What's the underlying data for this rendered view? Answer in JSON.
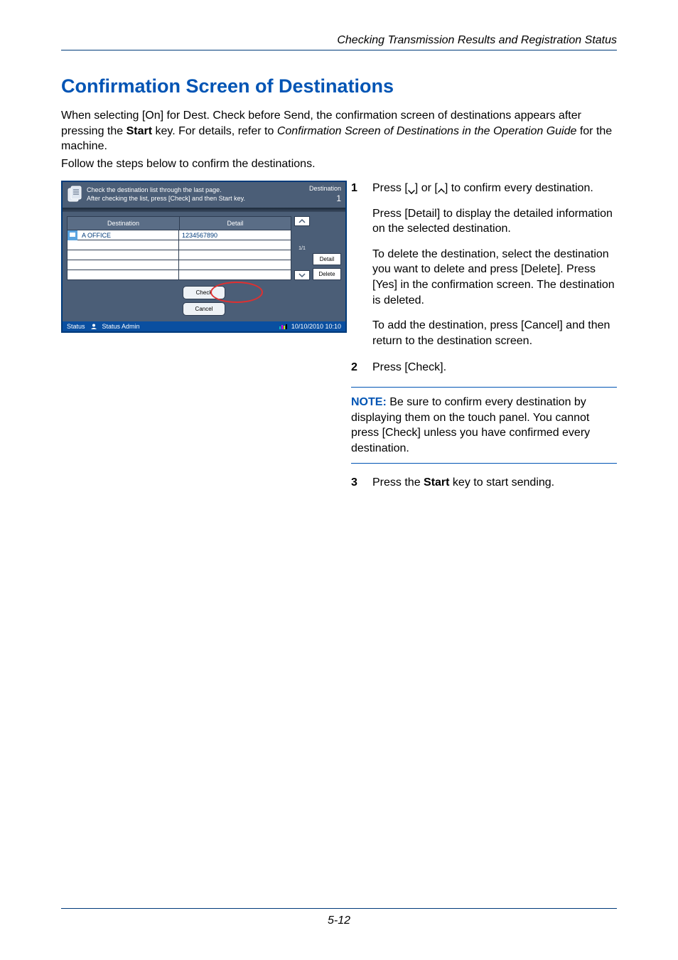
{
  "header": {
    "running": "Checking Transmission Results and Registration Status"
  },
  "title": "Confirmation Screen of Destinations",
  "intro": {
    "l1a": "When selecting [On] for Dest. Check before Send, the confirmation screen of destinations appears after",
    "l2a": "pressing the ",
    "l2b": "Start",
    "l2c": " key. For details, refer to ",
    "l2d": "Confirmation Screen of Destinations in the Operation Guide",
    "l2e": " for the",
    "l3": "machine."
  },
  "follow": "Follow the steps below to confirm the destinations.",
  "screenshot": {
    "header_line1": "Check the destination list through the last page.",
    "header_line2": "After checking the list, press [Check] and then Start key.",
    "header_right_label": "Destination",
    "header_right_count": "1",
    "col_dest": "Destination",
    "col_detail": "Detail",
    "row1_dest": "A OFFICE",
    "row1_detail": "1234567890",
    "page": "1/1",
    "btn_detail": "Detail",
    "btn_delete": "Delete",
    "btn_cancel": "Cancel",
    "btn_check": "Check",
    "status_label": "Status",
    "status_user": "Status  Admin",
    "status_time": "10/10/2010  10:10"
  },
  "steps": {
    "s1": {
      "num": "1",
      "p1a": "Press [",
      "p1b": "] or [",
      "p1c": "] to confirm every destination.",
      "p2": "Press [Detail] to display the detailed information on the selected destination.",
      "p3": "To delete the destination, select the destination you want to delete and press [Delete]. Press [Yes] in the confirmation screen. The destination is deleted.",
      "p4": "To add the destination, press [Cancel] and then return to the destination screen."
    },
    "s2": {
      "num": "2",
      "p1": "Press [Check]."
    },
    "note": {
      "label": "NOTE:",
      "text": " Be sure to confirm every destination by displaying them on the touch panel. You cannot press [Check] unless you have confirmed every destination."
    },
    "s3": {
      "num": "3",
      "p1a": "Press the ",
      "p1b": "Start",
      "p1c": " key to start sending."
    }
  },
  "footer": {
    "page": "5-12"
  }
}
